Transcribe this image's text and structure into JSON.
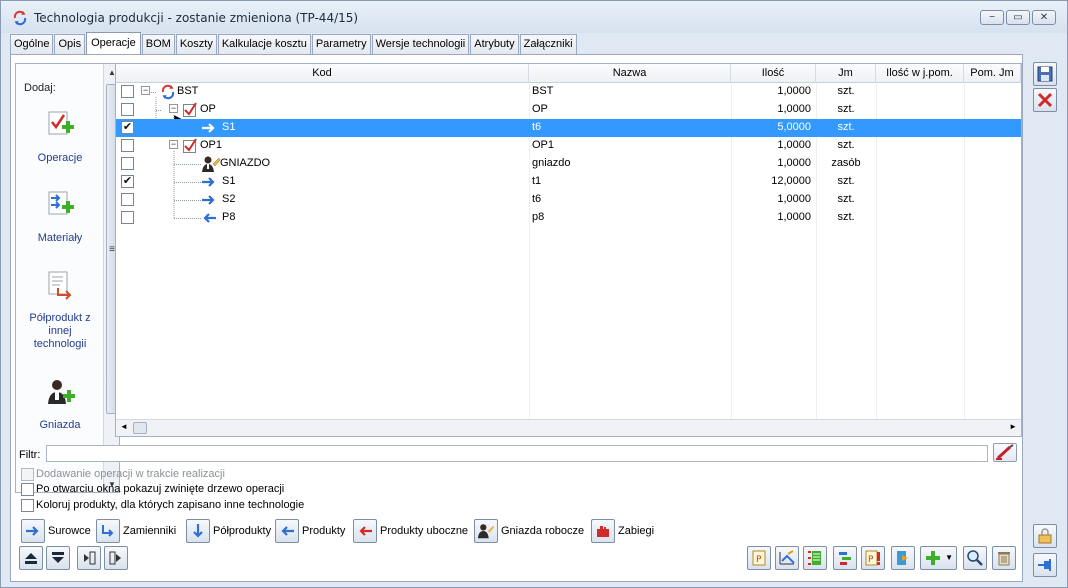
{
  "window": {
    "title": "Technologia produkcji - zostanie zmieniona  (TP-44/15)",
    "minimize": "−",
    "maximize": "▭",
    "close": "✕"
  },
  "tabs": [
    {
      "label": "Ogólne"
    },
    {
      "label": "Opis"
    },
    {
      "label": "Operacje",
      "active": true
    },
    {
      "label": "BOM"
    },
    {
      "label": "Koszty"
    },
    {
      "label": "Kalkulacje kosztu"
    },
    {
      "label": "Parametry"
    },
    {
      "label": "Wersje technologii"
    },
    {
      "label": "Atrybuty"
    },
    {
      "label": "Załączniki"
    }
  ],
  "add_panel": {
    "label": "Dodaj:",
    "items": [
      {
        "label": "Operacje",
        "icon": "add-operation-icon"
      },
      {
        "label": "Materiały",
        "icon": "add-material-icon"
      },
      {
        "label": "Półprodukt z innej technologii",
        "icon": "semi-product-icon"
      },
      {
        "label": "Gniazda",
        "icon": "add-workstation-icon"
      }
    ]
  },
  "grid": {
    "columns": [
      "Kod",
      "Nazwa",
      "Ilość",
      "Jm",
      "Ilość w j.pom.",
      "Pom. Jm"
    ],
    "rows": [
      {
        "checked": false,
        "kod": "BST",
        "nazwa": "BST",
        "ilosc": "1,0000",
        "jm": "szt.",
        "icon": "technology-icon",
        "selected": false
      },
      {
        "checked": false,
        "kod": "OP",
        "nazwa": "OP",
        "ilosc": "1,0000",
        "jm": "szt.",
        "icon": "operation-check-icon",
        "selected": false
      },
      {
        "checked": true,
        "kod": "S1",
        "nazwa": "t6",
        "ilosc": "5,0000",
        "jm": "szt.",
        "icon": "raw-material-arrow-icon",
        "selected": true
      },
      {
        "checked": false,
        "kod": "OP1",
        "nazwa": "OP1",
        "ilosc": "1,0000",
        "jm": "szt.",
        "icon": "operation-check-icon",
        "selected": false
      },
      {
        "checked": false,
        "kod": "GNIAZDO",
        "nazwa": "gniazdo",
        "ilosc": "1,0000",
        "jm": "zasób",
        "icon": "workstation-icon",
        "selected": false
      },
      {
        "checked": true,
        "kod": "S1",
        "nazwa": "t1",
        "ilosc": "12,0000",
        "jm": "szt.",
        "icon": "raw-material-arrow-icon",
        "selected": false
      },
      {
        "checked": false,
        "kod": "S2",
        "nazwa": "t6",
        "ilosc": "1,0000",
        "jm": "szt.",
        "icon": "raw-material-arrow-icon",
        "selected": false
      },
      {
        "checked": false,
        "kod": "P8",
        "nazwa": "p8",
        "ilosc": "1,0000",
        "jm": "szt.",
        "icon": "product-arrow-icon",
        "selected": false
      }
    ]
  },
  "filter": {
    "label": "Filtr:",
    "value": ""
  },
  "options": [
    {
      "label": "Dodawanie operacji w trakcie realizacji",
      "checked": false,
      "disabled": true
    },
    {
      "label": "Po otwarciu okna pokazuj zwinięte drzewo operacji",
      "checked": false,
      "disabled": false
    },
    {
      "label": "Koloruj produkty, dla których zapisano inne technologie",
      "checked": false,
      "disabled": false
    }
  ],
  "legend": [
    {
      "label": "Surowce"
    },
    {
      "label": "Zamienniki"
    },
    {
      "label": "Półprodukty"
    },
    {
      "label": "Produkty"
    },
    {
      "label": "Produkty uboczne"
    },
    {
      "label": "Gniazda robocze"
    },
    {
      "label": "Zabiegi"
    }
  ],
  "colors": {
    "selection": "#3399ff",
    "link_text": "#243b8f",
    "arrow_blue": "#2f6fd6",
    "check_red": "#d12a2a"
  }
}
